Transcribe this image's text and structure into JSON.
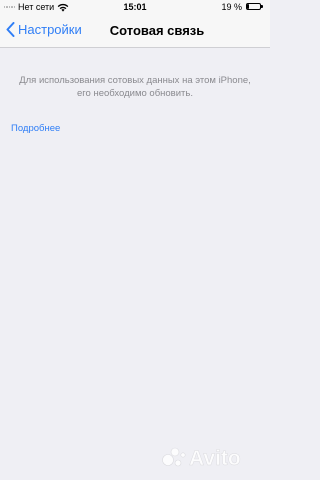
{
  "status_bar": {
    "carrier": "Нет сети",
    "time": "15:01",
    "battery": "19 %"
  },
  "nav": {
    "back_label": "Настройки",
    "title": "Сотовая связь"
  },
  "notice": {
    "line1": "Для использования сотовых данных на этом iPhone,",
    "line2": "его необходимо обновить."
  },
  "link": {
    "label": "Подробнее"
  },
  "colors": {
    "accent": "#2f7ef6",
    "background": "#efeff4",
    "secondary_text": "#8a8a8f"
  },
  "icons": {
    "signal": "signal-dots-icon",
    "wifi": "wifi-icon",
    "battery": "battery-icon",
    "back": "chevron-left-icon",
    "watermark": "avito-logo"
  },
  "watermark": {
    "text": "Avito"
  }
}
